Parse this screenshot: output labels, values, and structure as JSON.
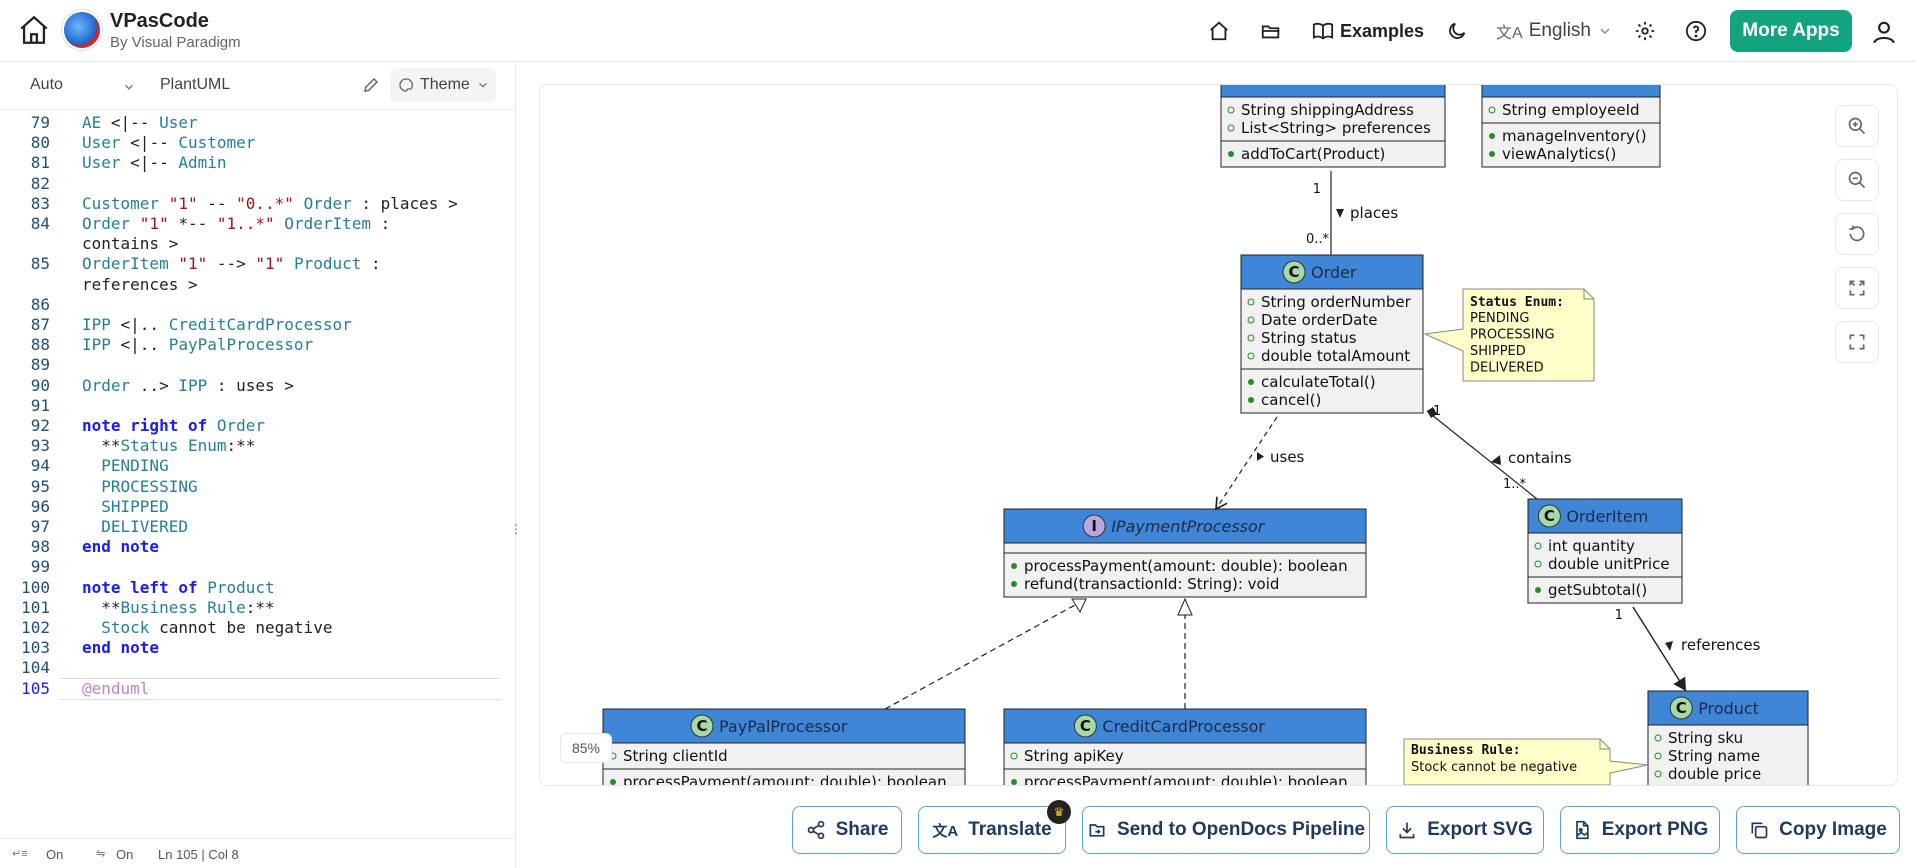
{
  "app": {
    "title": "VPasCode",
    "subtitle": "By Visual Paradigm"
  },
  "nav": {
    "examples": "Examples",
    "language": "English",
    "more_apps": "More Apps"
  },
  "editor": {
    "mode": "Auto",
    "language": "PlantUML",
    "theme": "Theme",
    "status": {
      "wrap": "On",
      "format": "On",
      "position": "Ln 105 | Col 8"
    }
  },
  "code_lines": [
    {
      "n": "79",
      "segs": [
        [
          "ty",
          "AE "
        ],
        [
          "",
          "<|-- "
        ],
        [
          "ty",
          "User"
        ]
      ]
    },
    {
      "n": "80",
      "segs": [
        [
          "ty",
          "User "
        ],
        [
          "",
          "<|-- "
        ],
        [
          "ty",
          "Customer"
        ]
      ]
    },
    {
      "n": "81",
      "segs": [
        [
          "ty",
          "User "
        ],
        [
          "",
          "<|-- "
        ],
        [
          "ty",
          "Admin"
        ]
      ]
    },
    {
      "n": "82",
      "segs": []
    },
    {
      "n": "83",
      "segs": [
        [
          "ty",
          "Customer "
        ],
        [
          "st",
          "\"1\""
        ],
        [
          "",
          " -- "
        ],
        [
          "st",
          "\"0..*\""
        ],
        [
          "ty",
          " Order"
        ],
        [
          "",
          " : places >"
        ]
      ]
    },
    {
      "n": "84",
      "segs": [
        [
          "ty",
          "Order "
        ],
        [
          "st",
          "\"1\""
        ],
        [
          "",
          " *-- "
        ],
        [
          "st",
          "\"1..*\""
        ],
        [
          "ty",
          " OrderItem"
        ],
        [
          "",
          " :"
        ]
      ]
    },
    {
      "n": "",
      "segs": [
        [
          "",
          "contains >"
        ]
      ]
    },
    {
      "n": "85",
      "segs": [
        [
          "ty",
          "OrderItem "
        ],
        [
          "st",
          "\"1\""
        ],
        [
          "",
          " --> "
        ],
        [
          "st",
          "\"1\""
        ],
        [
          "ty",
          " Product"
        ],
        [
          "",
          " :"
        ]
      ]
    },
    {
      "n": "",
      "segs": [
        [
          "",
          "references >"
        ]
      ]
    },
    {
      "n": "86",
      "segs": []
    },
    {
      "n": "87",
      "segs": [
        [
          "ty",
          "IPP "
        ],
        [
          "",
          "<|.. "
        ],
        [
          "ty",
          "CreditCardProcessor"
        ]
      ]
    },
    {
      "n": "88",
      "segs": [
        [
          "ty",
          "IPP "
        ],
        [
          "",
          "<|.. "
        ],
        [
          "ty",
          "PayPalProcessor"
        ]
      ]
    },
    {
      "n": "89",
      "segs": []
    },
    {
      "n": "90",
      "segs": [
        [
          "ty",
          "Order "
        ],
        [
          "",
          "..> "
        ],
        [
          "ty",
          "IPP"
        ],
        [
          "",
          " : uses >"
        ]
      ]
    },
    {
      "n": "91",
      "segs": []
    },
    {
      "n": "92",
      "segs": [
        [
          "kw",
          "note right of "
        ],
        [
          "ty",
          "Order"
        ]
      ]
    },
    {
      "n": "93",
      "segs": [
        [
          "",
          "  **"
        ],
        [
          "ty",
          "Status Enum"
        ],
        [
          "",
          ":**"
        ]
      ]
    },
    {
      "n": "94",
      "segs": [
        [
          "ty",
          "  PENDING"
        ]
      ]
    },
    {
      "n": "95",
      "segs": [
        [
          "ty",
          "  PROCESSING"
        ]
      ]
    },
    {
      "n": "96",
      "segs": [
        [
          "ty",
          "  SHIPPED"
        ]
      ]
    },
    {
      "n": "97",
      "segs": [
        [
          "ty",
          "  DELIVERED"
        ]
      ]
    },
    {
      "n": "98",
      "segs": [
        [
          "kw",
          "end note"
        ]
      ]
    },
    {
      "n": "99",
      "segs": []
    },
    {
      "n": "100",
      "segs": [
        [
          "kw",
          "note left of "
        ],
        [
          "ty",
          "Product"
        ]
      ]
    },
    {
      "n": "101",
      "segs": [
        [
          "",
          "  **"
        ],
        [
          "ty",
          "Business Rule"
        ],
        [
          "",
          ":**"
        ]
      ]
    },
    {
      "n": "102",
      "segs": [
        [
          "ty",
          "  Stock "
        ],
        [
          "",
          "cannot be negative"
        ]
      ]
    },
    {
      "n": "103",
      "segs": [
        [
          "kw",
          "end note"
        ]
      ]
    },
    {
      "n": "104",
      "segs": []
    },
    {
      "n": "105",
      "segs": [
        [
          "kwm",
          "@enduml"
        ]
      ]
    }
  ],
  "diagram": {
    "zoom": "85%",
    "classes": {
      "customer": {
        "fields": [
          "String shippingAddress",
          "List<String> preferences"
        ],
        "methods": [
          "addToCart(Product)"
        ]
      },
      "admin": {
        "fields": [
          "String employeeId"
        ],
        "methods": [
          "manageInventory()",
          "viewAnalytics()"
        ]
      },
      "order": {
        "name": "Order",
        "fields": [
          "String orderNumber",
          "Date orderDate",
          "String status",
          "double totalAmount"
        ],
        "methods": [
          "calculateTotal()",
          "cancel()"
        ]
      },
      "ipp": {
        "name": "IPaymentProcessor",
        "methods": [
          "processPayment(amount: double): boolean",
          "refund(transactionId: String): void"
        ]
      },
      "orderitem": {
        "name": "OrderItem",
        "fields": [
          "int quantity",
          "double unitPrice"
        ],
        "methods": [
          "getSubtotal()"
        ]
      },
      "paypal": {
        "name": "PayPalProcessor",
        "fields": [
          "String clientId"
        ],
        "methods": [
          "processPayment(amount: double): boolean"
        ]
      },
      "credit": {
        "name": "CreditCardProcessor",
        "fields": [
          "String apiKey"
        ],
        "methods": [
          "processPayment(amount: double): boolean"
        ]
      },
      "product": {
        "name": "Product",
        "fields": [
          "String sku",
          "String name",
          "double price"
        ]
      }
    },
    "notes": {
      "status_title": "Status Enum:",
      "status_items": [
        "PENDING",
        "PROCESSING",
        "SHIPPED",
        "DELIVERED"
      ],
      "rule_title": "Business Rule:",
      "rule_text": "Stock cannot be negative"
    },
    "labels": {
      "places": "places",
      "places_m1": "1",
      "places_m2": "0..*",
      "uses": "uses",
      "contains": "contains",
      "contains_m1": "1",
      "contains_m2": "1..*",
      "references": "references",
      "references_m1": "1"
    }
  },
  "actions": {
    "share": "Share",
    "translate": "Translate",
    "opendocs": "Send to OpenDocs Pipeline",
    "svg": "Export SVG",
    "png": "Export PNG",
    "copy": "Copy Image"
  }
}
